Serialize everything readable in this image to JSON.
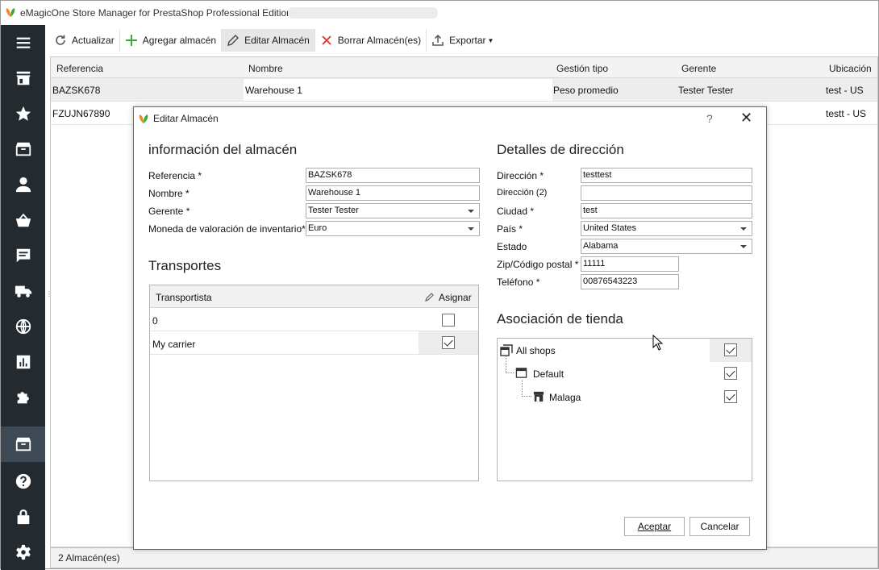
{
  "window": {
    "title": "eMagicOne Store Manager for PrestaShop Professional Edition"
  },
  "sidebar": {
    "items": [
      {
        "icon": "menu-icon"
      },
      {
        "icon": "store-icon"
      },
      {
        "icon": "star-icon"
      },
      {
        "icon": "box-icon"
      },
      {
        "icon": "user-icon"
      },
      {
        "icon": "basket-icon"
      },
      {
        "icon": "message-icon"
      },
      {
        "icon": "truck-icon"
      },
      {
        "icon": "globe-icon"
      },
      {
        "icon": "chart-icon"
      },
      {
        "icon": "puzzle-icon"
      },
      {
        "icon": "warehouse-icon"
      },
      {
        "icon": "help-icon"
      },
      {
        "icon": "lock-icon"
      },
      {
        "icon": "gear-icon"
      }
    ]
  },
  "toolbar": {
    "refresh": "Actualizar",
    "add": "Agregar almacén",
    "edit": "Editar Almacén",
    "delete": "Borrar Almacén(es)",
    "export": "Exportar"
  },
  "grid": {
    "columns": [
      "Referencia",
      "Nombre",
      "Gestión tipo",
      "Gerente",
      "Ubicación"
    ],
    "rows": [
      {
        "ref": "BAZSK678",
        "name": "Warehouse 1",
        "type": "Peso promedio",
        "manager": "Tester Tester",
        "location": "test - US"
      },
      {
        "ref": "FZUJN67890",
        "name": "",
        "type": "",
        "manager": "",
        "location": "testt - US"
      }
    ]
  },
  "status": {
    "count": "2 Almacén(es)"
  },
  "dialog": {
    "title": "Editar Almacén",
    "help": "?",
    "close": "✕",
    "info": {
      "heading": "información del almacén",
      "ref_label": "Referencia *",
      "ref_value": "BAZSK678",
      "name_label": "Nombre *",
      "name_value": "Warehouse 1",
      "manager_label": "Gerente *",
      "manager_value": "Tester Tester",
      "currency_label": "Moneda de valoración de inventario*",
      "currency_value": "Euro"
    },
    "transport": {
      "heading": "Transportes",
      "col_carrier": "Transportista",
      "col_assign": "Asignar",
      "rows": [
        {
          "name": "0",
          "checked": false
        },
        {
          "name": "My carrier",
          "checked": true
        }
      ]
    },
    "address": {
      "heading": "Detalles de dirección",
      "addr1_label": "Dirección *",
      "addr1_value": "testtest",
      "addr2_label": "Dirección (2)",
      "addr2_value": "",
      "city_label": "Ciudad *",
      "city_value": "test",
      "country_label": "País *",
      "country_value": "United States",
      "state_label": "Estado",
      "state_value": "Alabama",
      "zip_label": "Zip/Código postal *",
      "zip_value": "11111",
      "phone_label": "Teléfono *",
      "phone_value": "00876543223"
    },
    "shop": {
      "heading": "Asociación de tienda",
      "items": [
        {
          "label": "All shops",
          "checked": true
        },
        {
          "label": "Default",
          "checked": true
        },
        {
          "label": "Malaga",
          "checked": true
        }
      ]
    },
    "accept": "Aceptar",
    "cancel": "Cancelar"
  },
  "colors": {
    "sidebar": "#232a30",
    "sidebar_active": "#3d4954",
    "accent_green": "#3aaa35",
    "delete_red": "#d9342b"
  }
}
